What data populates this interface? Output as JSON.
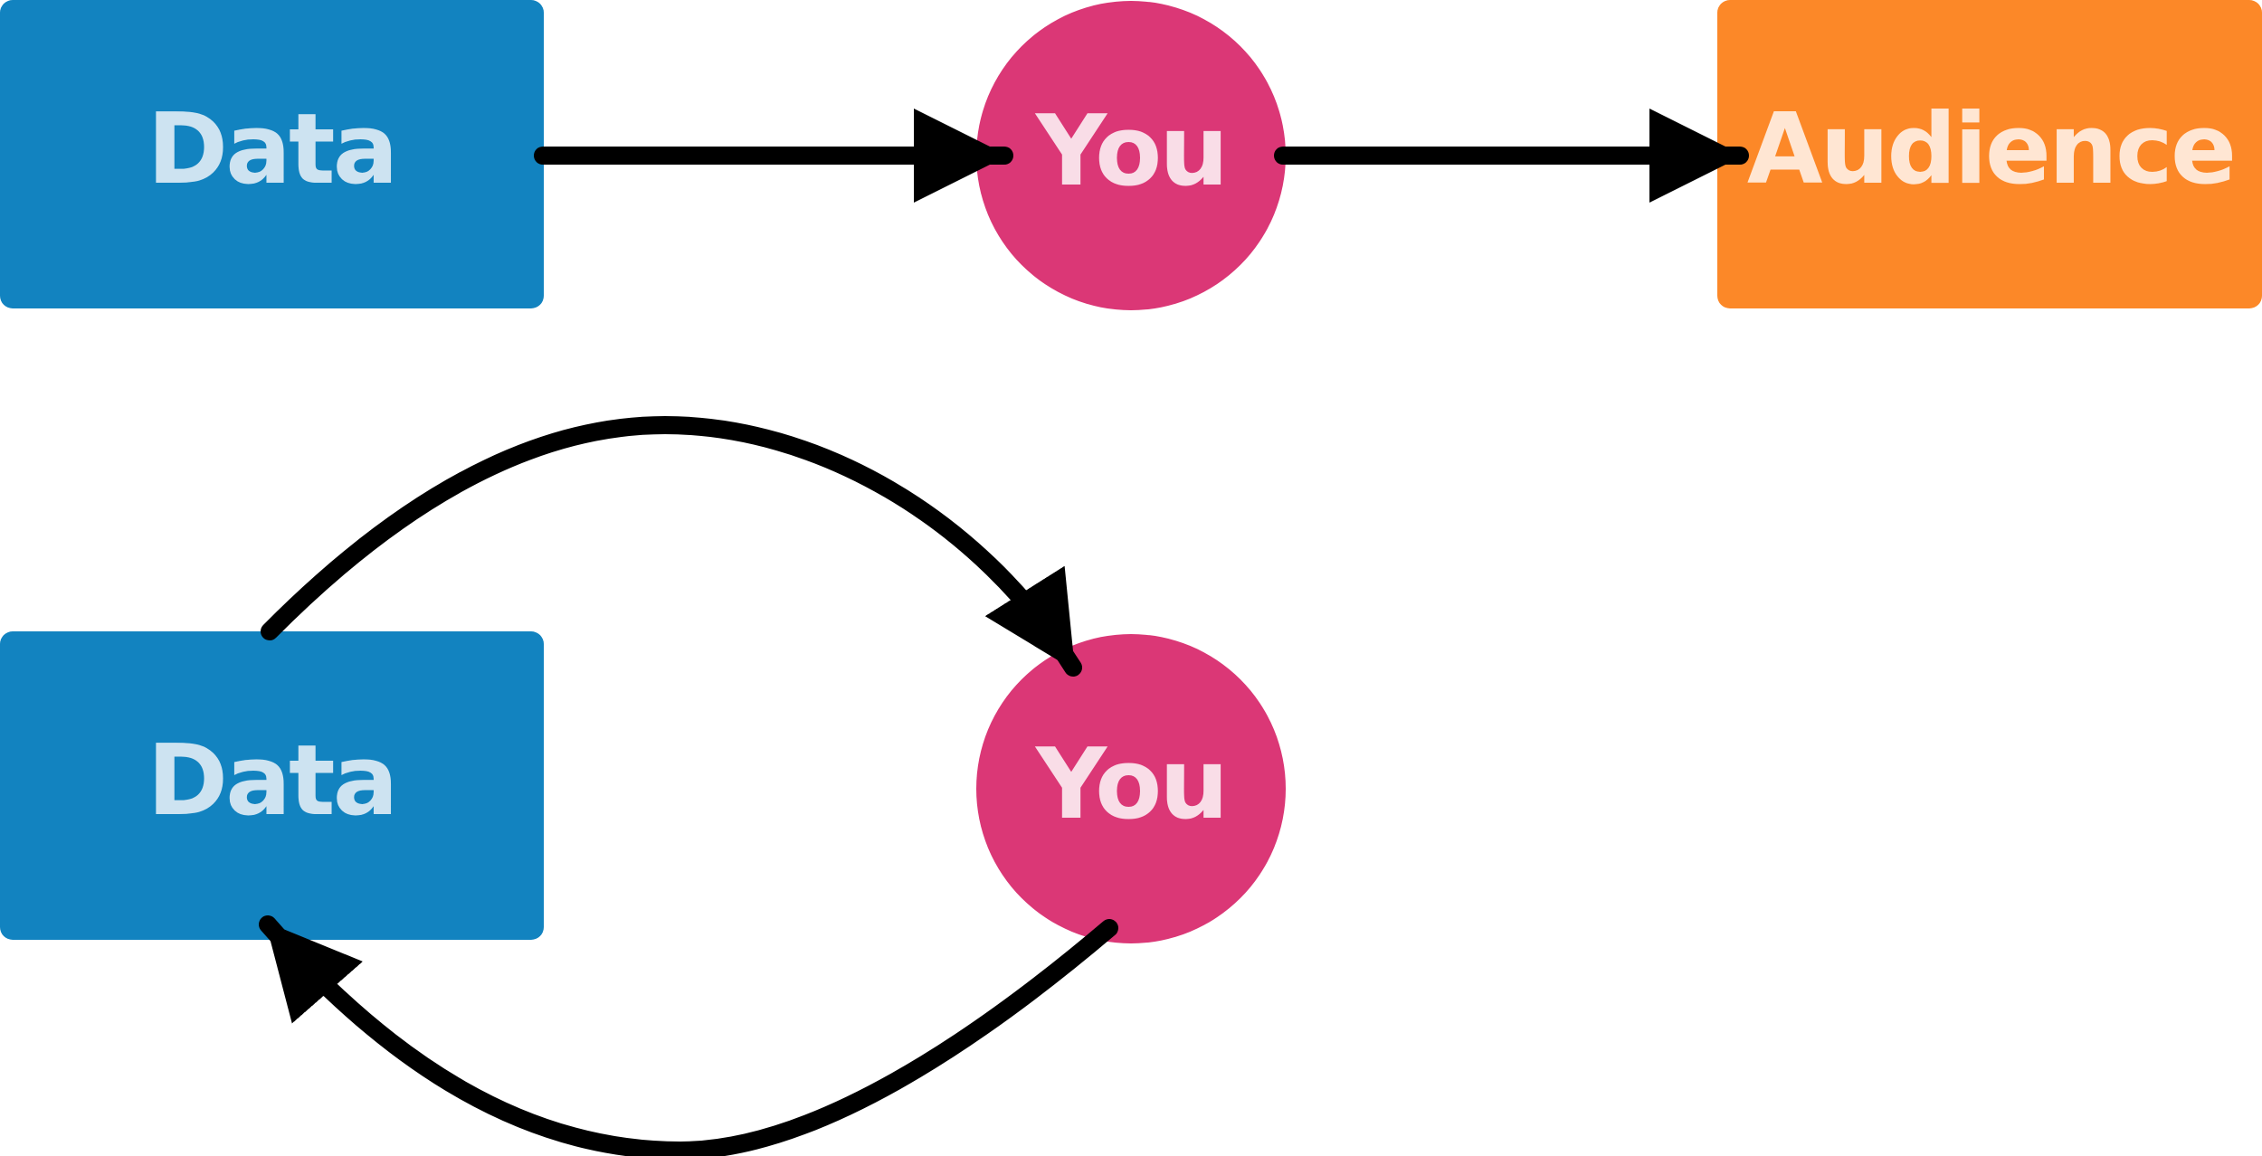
{
  "colors": {
    "data_fill": "#1283C0",
    "data_text": "#CDE3F1",
    "you_fill": "#DB3776",
    "you_text": "#F9DDE7",
    "audience_fill": "#FC8828",
    "audience_text": "#FFE6D3",
    "arrow": "#000000"
  },
  "top_row": {
    "data_label": "Data",
    "you_label": "You",
    "audience_label": "Audience"
  },
  "bottom_row": {
    "data_label": "Data",
    "you_label": "You"
  }
}
